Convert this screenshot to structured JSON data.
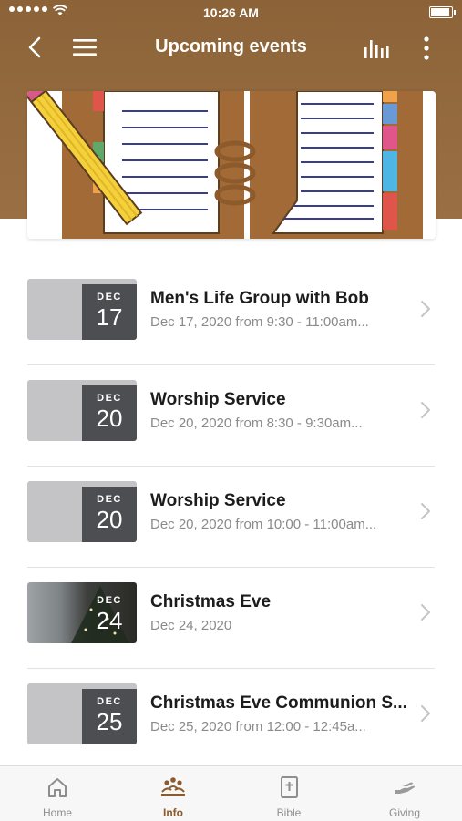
{
  "status_bar": {
    "time": "10:26 AM"
  },
  "nav": {
    "title": "Upcoming events"
  },
  "events": [
    {
      "month": "DEC",
      "day": "17",
      "title": "Men's Life Group with Bob",
      "subtitle": "Dec 17, 2020 from 9:30 - 11:00am..."
    },
    {
      "month": "DEC",
      "day": "20",
      "title": "Worship Service",
      "subtitle": "Dec 20, 2020 from 8:30 - 9:30am..."
    },
    {
      "month": "DEC",
      "day": "20",
      "title": "Worship Service",
      "subtitle": "Dec 20, 2020 from 10:00 - 11:00am..."
    },
    {
      "month": "DEC",
      "day": "24",
      "title": "Christmas Eve",
      "subtitle": "Dec 24, 2020"
    },
    {
      "month": "DEC",
      "day": "25",
      "title": "Christmas Eve Communion S...",
      "subtitle": "Dec 25, 2020 from 12:00 - 12:45a..."
    }
  ],
  "tabs": [
    {
      "label": "Home",
      "icon": "home-icon"
    },
    {
      "label": "Info",
      "icon": "people-icon"
    },
    {
      "label": "Bible",
      "icon": "bible-icon"
    },
    {
      "label": "Giving",
      "icon": "giving-hand-icon"
    }
  ],
  "colors": {
    "header_brown": "#8c6338",
    "active_tab": "#8c5a2b",
    "date_badge": "#4d4e51",
    "thumb_gray": "#c4c4c6"
  }
}
